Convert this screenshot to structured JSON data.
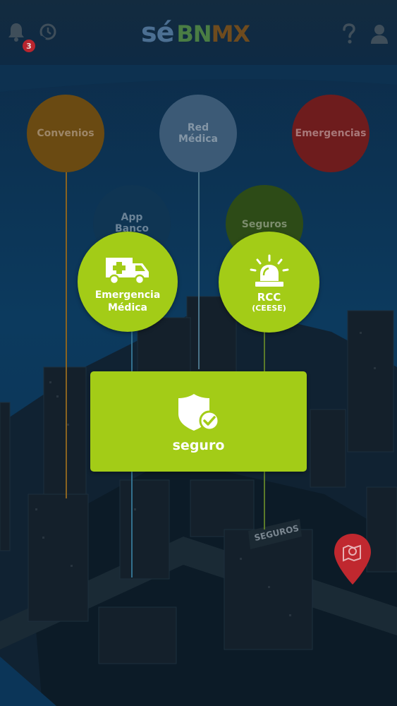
{
  "header": {
    "notification_count": "3",
    "logo": {
      "se": "sé",
      "bn": "BN",
      "mx": "MX"
    },
    "icons": [
      "bell-icon",
      "history-clock-icon",
      "help-icon",
      "user-icon"
    ]
  },
  "menu": {
    "convenios": "Convenios",
    "red_medica": "Red\nMédica",
    "emergencias": "Emergencias",
    "app_banco": "App\nBanco",
    "seguros": "Seguros"
  },
  "actions": {
    "emergencia_medica": "Emergencia\nMédica",
    "rcc_title": "RCC",
    "rcc_sub": "(CEESE)",
    "seguro": "seguro"
  },
  "map": {
    "building_sign": "SEGUROS",
    "pin_icon": "map-location-pin-icon"
  },
  "colors": {
    "accent_green": "#a3cc17",
    "convenios": "#6a4a12",
    "red_medica": "#3c5a76",
    "emergencias": "#6e1c1d",
    "app_banco": "#0f3553",
    "seguros": "#2d4b17",
    "pin_red": "#c0282f"
  }
}
